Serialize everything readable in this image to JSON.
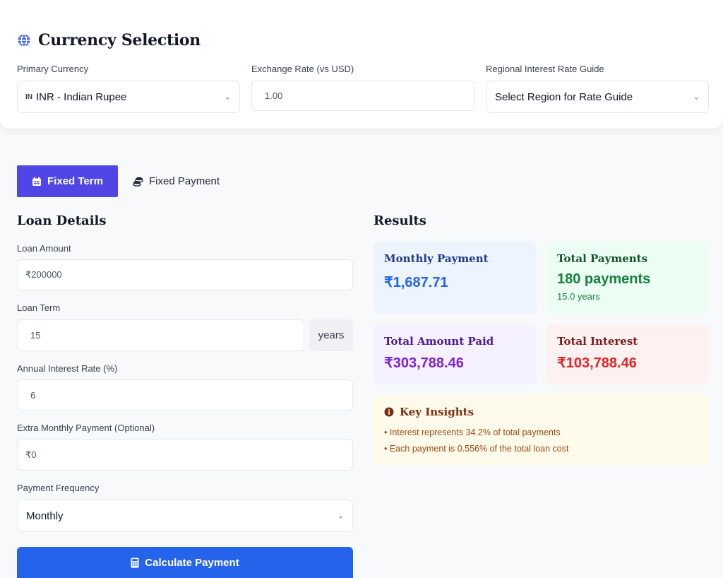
{
  "currency": {
    "title": "Currency Selection",
    "primary_label": "Primary Currency",
    "primary_code": "IN",
    "primary_value": "INR - Indian Rupee",
    "rate_label": "Exchange Rate (vs USD)",
    "rate_value": "1.00",
    "region_label": "Regional Interest Rate Guide",
    "region_value": "Select Region for Rate Guide"
  },
  "tabs": {
    "fixed_term": "Fixed Term",
    "fixed_payment": "Fixed Payment"
  },
  "loan": {
    "heading": "Loan Details",
    "amount_label": "Loan Amount",
    "amount_value": "₹200000",
    "term_label": "Loan Term",
    "term_value": "15",
    "term_unit": "years",
    "rate_label": "Annual Interest Rate (%)",
    "rate_value": "6",
    "extra_label": "Extra Monthly Payment (Optional)",
    "extra_value": "₹0",
    "freq_label": "Payment Frequency",
    "freq_value": "Monthly",
    "calc_button": "Calculate Payment"
  },
  "results": {
    "heading": "Results",
    "monthly_label": "Monthly Payment",
    "monthly_value": "₹1,687.71",
    "total_payments_label": "Total Payments",
    "total_payments_value": "180 payments",
    "total_payments_sub": "15.0 years",
    "total_paid_label": "Total Amount Paid",
    "total_paid_value": "₹303,788.46",
    "total_interest_label": "Total Interest",
    "total_interest_value": "₹103,788.46"
  },
  "insights": {
    "title": "Key Insights",
    "items": [
      "• Interest represents 34.2% of total payments",
      "• Each payment is 0.556% of the total loan cost"
    ]
  },
  "colors": {
    "primary": "#4f46e5",
    "button": "#2563eb",
    "monthly": "#2563eb",
    "payments": "#15803d",
    "paid": "#7e22ce",
    "interest": "#dc2626"
  }
}
